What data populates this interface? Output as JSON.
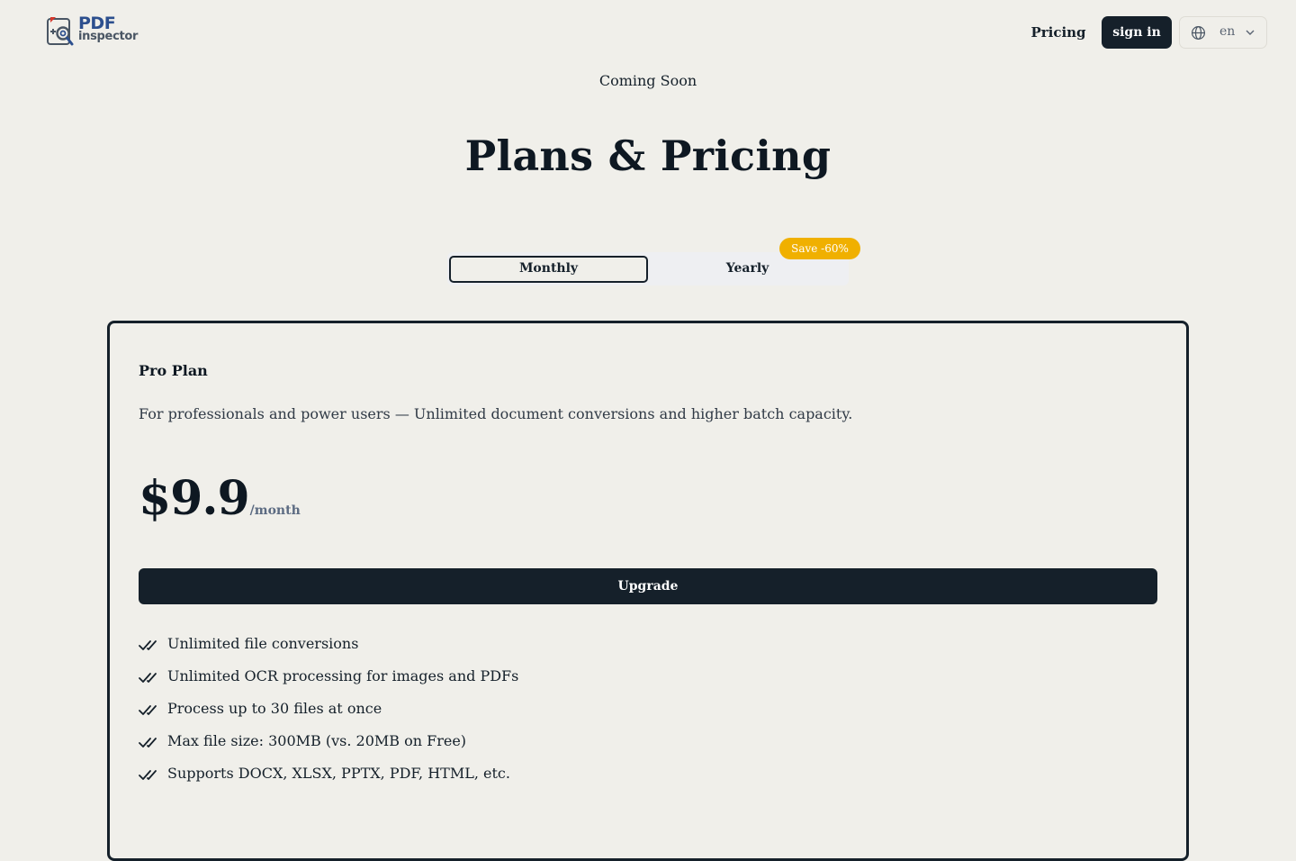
{
  "header": {
    "logo": {
      "line1": "PDF",
      "line2": "inspector"
    },
    "nav_pricing": "Pricing",
    "signin_label": "sign in",
    "language": {
      "selected": "en"
    }
  },
  "hero": {
    "eyebrow": "Coming Soon",
    "title": "Plans & Pricing"
  },
  "billing_toggle": {
    "options": [
      "Monthly",
      "Yearly"
    ],
    "selected": "Monthly",
    "badge": "Save -60%"
  },
  "plan": {
    "name": "Pro Plan",
    "description": "For professionals and power users — Unlimited document conversions and higher batch capacity.",
    "price": "$9.9",
    "period": "/month",
    "cta": "Upgrade",
    "features": [
      "Unlimited file conversions",
      "Unlimited OCR processing for images and PDFs",
      "Process up to 30 files at once",
      "Max file size: 300MB (vs. 20MB on Free)",
      "Supports DOCX, XLSX, PPTX, PDF, HTML, etc."
    ]
  },
  "colors": {
    "background": "#f0efea",
    "primary_dark": "#15202a",
    "badge": "#f0b000",
    "logo_blue": "#2c4f8e"
  }
}
